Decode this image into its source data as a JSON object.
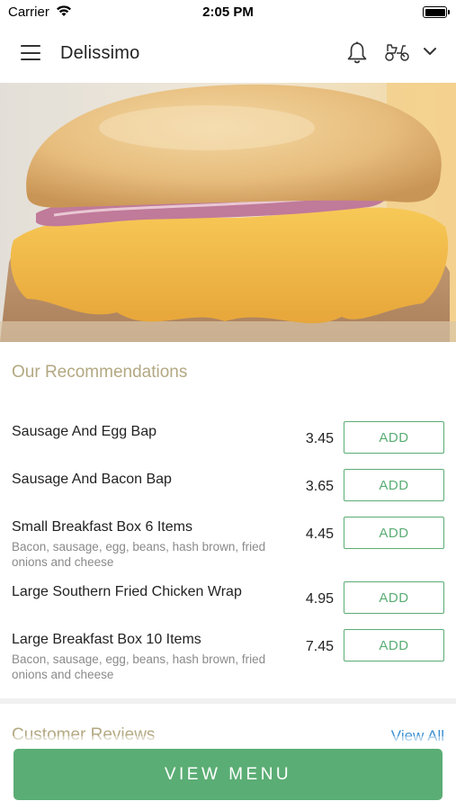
{
  "status_bar": {
    "carrier": "Carrier",
    "time": "2:05 PM"
  },
  "header": {
    "title": "Delissimo",
    "icons": [
      "menu-icon",
      "bell-icon",
      "scooter-icon",
      "chevron-down-icon"
    ]
  },
  "hero": {
    "image": "cheeseburger-photo"
  },
  "recommendations": {
    "title": "Our Recommendations",
    "items": [
      {
        "name": "Sausage And Egg Bap",
        "description": "",
        "price": "3.45",
        "add_label": "ADD"
      },
      {
        "name": "Sausage And Bacon Bap",
        "description": "",
        "price": "3.65",
        "add_label": "ADD"
      },
      {
        "name": "Small Breakfast Box 6 Items",
        "description": "Bacon, sausage, egg, beans, hash brown, fried onions and cheese",
        "price": "4.45",
        "add_label": "ADD"
      },
      {
        "name": "Large Southern Fried Chicken Wrap",
        "description": "",
        "price": "4.95",
        "add_label": "ADD"
      },
      {
        "name": "Large Breakfast Box 10 Items",
        "description": "Bacon, sausage, egg, beans, hash brown, fried onions and cheese",
        "price": "7.45",
        "add_label": "ADD"
      }
    ]
  },
  "reviews": {
    "title": "Customer Reviews",
    "view_all": "View All"
  },
  "footer": {
    "view_menu_label": "VIEW MENU"
  },
  "colors": {
    "accent_green": "#5aad74",
    "section_title": "#b3a882",
    "link_blue": "#3b8fd1"
  }
}
